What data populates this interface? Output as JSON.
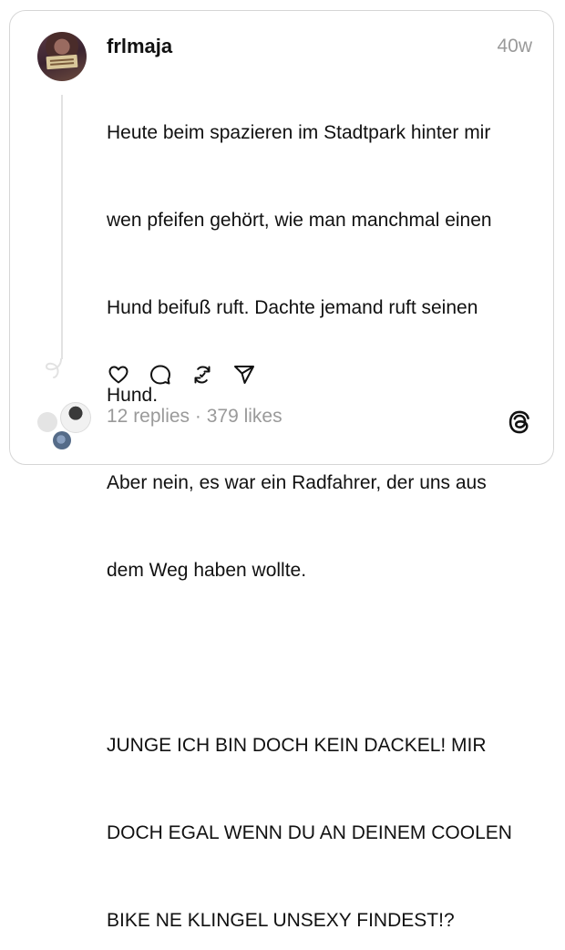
{
  "post": {
    "username": "frlmaja",
    "timestamp": "40w",
    "text_lines": [
      "Heute beim spazieren im Stadtpark hinter mir",
      "wen pfeifen gehört, wie man manchmal einen",
      "Hund beifuß ruft. Dachte jemand ruft seinen",
      "Hund.",
      "Aber nein, es war ein Radfahrer, der uns aus",
      "dem Weg haben wollte.",
      "",
      "JUNGE ICH BIN DOCH KEIN DACKEL! MIR",
      "DOCH EGAL WENN DU AN DEINEM COOLEN",
      "BIKE NE KLINGEL UNSEXY FINDEST!?"
    ],
    "stats": "12 replies · 379 likes"
  },
  "actions": [
    {
      "name": "like",
      "icon": "heart-icon"
    },
    {
      "name": "reply",
      "icon": "comment-icon"
    },
    {
      "name": "repost",
      "icon": "repost-icon"
    },
    {
      "name": "share",
      "icon": "send-icon"
    }
  ],
  "brand": {
    "logo": "threads-logo-icon",
    "accent": "#111111",
    "muted": "#9a9a9a"
  }
}
